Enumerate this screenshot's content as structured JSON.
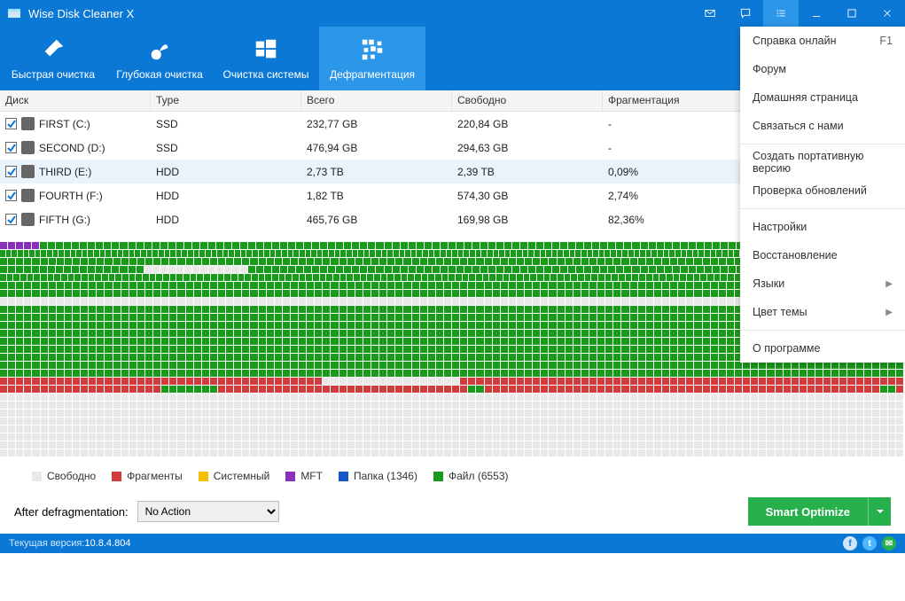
{
  "titlebar": {
    "title": "Wise Disk Cleaner X"
  },
  "nav": {
    "tabs": [
      {
        "label": "Быстрая очистка"
      },
      {
        "label": "Глубокая очистка"
      },
      {
        "label": "Очистка системы"
      },
      {
        "label": "Дефрагментация"
      }
    ],
    "active_index": 3
  },
  "table": {
    "headers": {
      "disk": "Диск",
      "type": "Type",
      "total": "Всего",
      "free": "Свободно",
      "frag": "Фрагментация"
    },
    "rows": [
      {
        "name": "FIRST (C:)",
        "type": "SSD",
        "total": "232,77 GB",
        "free": "220,84 GB",
        "frag": "-"
      },
      {
        "name": "SECOND (D:)",
        "type": "SSD",
        "total": "476,94 GB",
        "free": "294,63 GB",
        "frag": "-"
      },
      {
        "name": "THIRD (E:)",
        "type": "HDD",
        "total": "2,73 TB",
        "free": "2,39 TB",
        "frag": "0,09%"
      },
      {
        "name": "FOURTH (F:)",
        "type": "HDD",
        "total": "1,82 TB",
        "free": "574,30 GB",
        "frag": "2,74%"
      },
      {
        "name": "FIFTH (G:)",
        "type": "HDD",
        "total": "465,76 GB",
        "free": "169,98 GB",
        "frag": "82,36%"
      }
    ],
    "selected_index": 2
  },
  "disk_map": {
    "pattern": "pppppgggggggggggggggggggggggggggggggggggggggggggggggggggggggggggggggggggggggggggggggggggggggggggggggggggggggggggg|gggggggggggggggggggggggggggggggggggggggggggggggggggggggggggggggggggggggggggggggggggggggggggggggggggggggggggggggggggggggggggggggggggggggggggggggggggggggggg|gggggggggggggggggggggggggggggggggggggggggggggggggggggggggggggggggggggggggggggggggggggggggggggggggggggggggggggggg|ggggggggggggggggggwwwwwwwwwwwwwgggggggggggggggggggggggggggggggggggggggggggggggggggggggggggggggggggggggggggggggggg|gggggggggggggggggggggggggggggggggggggggggggggggggggggggggggggggggggggggggggggggggggggggggggggggggggggggggggggggggggwwgggggggggggggggg|gggggggggggggggggggggggggggggggggggggggggggggggggggggggggggggggggggggggggggggggggggggggggggggggggggggggggggggggg|gggggggggggggggggggggggggggggggggggggggggggggggggggggggggggggggggggggggggggggggggggggggggggggggggggggggggggggggg|wwwwwwwwwwwwwwwwwwwwwwwwwwwwwwwwwwwwwwwwwwwwwwwwwwwwwwwwwwwwwwwwwwwwwwwwwwwwwwwwwwwwwwwwwwwwwwwwwwwwwwwwwwwwwwww|ggggggggggggggggggggggggggggggggggggggggggggggggggggggggggggggggggggggggggggggggggggggggggggggggggwwgggggggggwgg|gggggggggggggggggggggggggggggggggggggggggggggggggggggggggggggggggggggggggggggggggggggggggggggggggggggggggggggggg|gggggggggggggggggggggggggggggggggggggggggggggggggggggggggggggggggggggggggggggggggggggggggggggggggggggggggggggggg|gggggggggggggggggggggggggggggggggggggggggggggggggggggggggggggggggggggggggggggggggggggggggggggggggggggggggggggggg|gggggggggggggggggggggggggggggggggggggggggggggggggggggggggggggggggggggggggggggggggggggggggggggggggggggggggggggggg|gggggggggggggggggggggggggggggggggggggggggggggggggggggggggggggggggggggggggggggggggggggggggggggggggggggggggggggggg|gggggggggggggggggggggggggggggggggggggggggggggggggggggggggggggggggggggggggggggggggggggggggggggggggggggggggggggggg|gggggggggggggggggggggggggggggggggggggggggggggggggggggggggggggggggggggggggggggggggggggggggggggggggggggggggggggggg|gggggggggggggggggggggggggggggggggggggggggggggggggggggggggggggggggggggggggggggggggggggggggggggggggggggggggggggggg|rrrrrrrrrrrrrrrrrrrrrrrrrrrrrrrrrrrrrrrrwwwwwwwwwwwwwwwwwrrrrrrrrrrrrrrrrrrrrrrrrrrrrrrrrrrrrrrrrrrrrrrrrrrrrrrr|rrrrrrrrrrrrrrrrrrrrgggggggrrrrrrrrrrrrrrrrrrrrrrrrrrrrrrrggrrrrrrrrrrrrrrrrrrrrrrrrrrrrrrrrrrrrrrrrrrrrrrrrrggr|wwwwwwwwwwwwwwwwwwwwwwwwwwwwwwwwwwwwwwwwwwwwwwwwwwwwwwwwwwwwwwwwwwwwwwwwwwwwwwwwwwwwwwwwwwwwwwwwwwwwwwwwwwwwwwww|wwwwwwwwwwwwwwwwwwwwwwwwwwwwwwwwwwwwwwwwwwwwwwwwwwwwwwwwwwwwwwwwwwwwwwwwwwwwwwwwwwwwwwwwwwwwwwwwwwwwwwwwwwwwwwww|wwwwwwwwwwwwwwwwwwwwwwwwwwwwwwwwwwwwwwwwwwwwwwwwwwwwwwwwwwwwwwwwwwwwwwwwwwwwwwwwwwwwwwwwwwwwwwwwwwwwwwwwwwwwwwww|wwwwwwwwwwwwwwwwwwwwwwwwwwwwwwwwwwwwwwwwwwwwwwwwwwwwwwwwwwwwwwwwwwwwwwwwwwwwwwwwwwwwwwwwwwwwwwwwwwwwwwwwwwwwwwww|wwwwwwwwwwwwwwwwwwwwwwwwwwwwwwwwwwwwwwwwwwwwwwwwwwwwwwwwwwwwwwwwwwwwwwwwwwwwwwwwwwwwwwwwwwwwwwwwwwwwwwwwwwwwwwww|wwwwwwwwwwwwwwwwwwwwwwwwwwwwwwwwwwwwwwwwwwwwwwwwwwwwwwwwwwwwwwwwwwwwwwwwwwwwwwwwwwwwwwwwwwwwwwwwwwwwwwwwwwwwwwww|wwwwwwwwwwwwwwwwwwwwwwwwwwwwwwwwwwwwwwwwwwwwwwwwwwwwwwwwwwwwwwwwwwwwwwwwwwwwwwwwwwwwwwwwwwwwwwwwwwwwwwwwwwwwwwww|wwwwwwwwwwwwwwwwwwwwwwwwwwwwwwwwwwwwwwwwwwwwwwwwwwwwwwwwwwwwwwwwwwwwwwwwwwwwwwwwwwwwwwwwwwwwwwwwwwwwwwwwwwwwwwww"
  },
  "legend": {
    "free": {
      "label": "Свободно",
      "color": "#e9e9e9"
    },
    "frag": {
      "label": "Фрагменты",
      "color": "#d23b3b"
    },
    "system": {
      "label": "Системный",
      "color": "#f2c200"
    },
    "mft": {
      "label": "MFT",
      "color": "#8a2fbb"
    },
    "folder": {
      "label": "Папка (1346)",
      "color": "#1657c8"
    },
    "file": {
      "label": "Файл (6553)",
      "color": "#1a9a1a"
    }
  },
  "bottom": {
    "after_label": "After defragmentation:",
    "action_selected": "No Action",
    "smart_label": "Smart Optimize"
  },
  "status": {
    "version_label": "Текущая версия:",
    "version_value": "10.8.4.804"
  },
  "menu": {
    "items": [
      {
        "label": "Справка онлайн",
        "shortcut": "F1"
      },
      {
        "label": "Форум"
      },
      {
        "label": "Домашняя страница"
      },
      {
        "label": "Связаться с нами"
      },
      {
        "sep": true
      },
      {
        "label": "Создать портативную версию"
      },
      {
        "label": "Проверка обновлений"
      },
      {
        "sep": true
      },
      {
        "label": "Настройки"
      },
      {
        "label": "Восстановление"
      },
      {
        "label": "Языки",
        "submenu": true
      },
      {
        "label": "Цвет темы",
        "submenu": true
      },
      {
        "sep": true
      },
      {
        "label": "О программе"
      }
    ]
  }
}
